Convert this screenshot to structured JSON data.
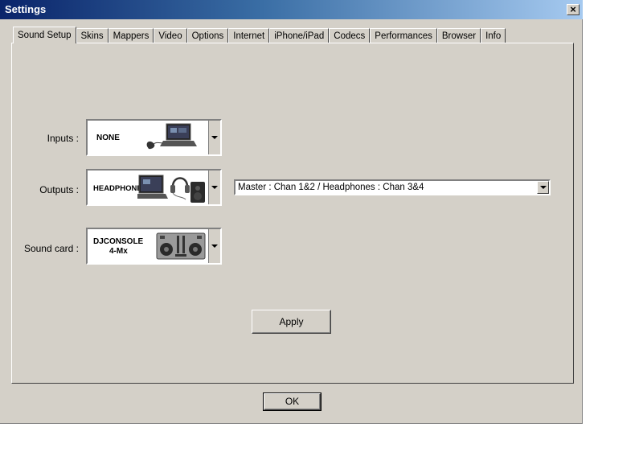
{
  "window": {
    "title": "Settings",
    "close_glyph": "×"
  },
  "tabs": [
    {
      "label": "Sound Setup",
      "active": true
    },
    {
      "label": "Skins"
    },
    {
      "label": "Mappers"
    },
    {
      "label": "Video"
    },
    {
      "label": "Options"
    },
    {
      "label": "Internet"
    },
    {
      "label": "iPhone/iPad"
    },
    {
      "label": "Codecs"
    },
    {
      "label": "Performances"
    },
    {
      "label": "Browser"
    },
    {
      "label": "Info"
    }
  ],
  "sound_setup": {
    "inputs": {
      "label": "Inputs :",
      "value": "NONE",
      "icon": "laptop-mouse-icon"
    },
    "outputs": {
      "label": "Outputs :",
      "value": "HEADPHONES",
      "icon": "laptop-headphones-speaker-icon",
      "routing": "Master : Chan 1&2 / Headphones : Chan 3&4"
    },
    "sound_card": {
      "label": "Sound card :",
      "value_line1": "DJCONSOLE",
      "value_line2": "4-Mx",
      "icon": "dj-controller-icon"
    },
    "apply_label": "Apply"
  },
  "ok_label": "OK"
}
